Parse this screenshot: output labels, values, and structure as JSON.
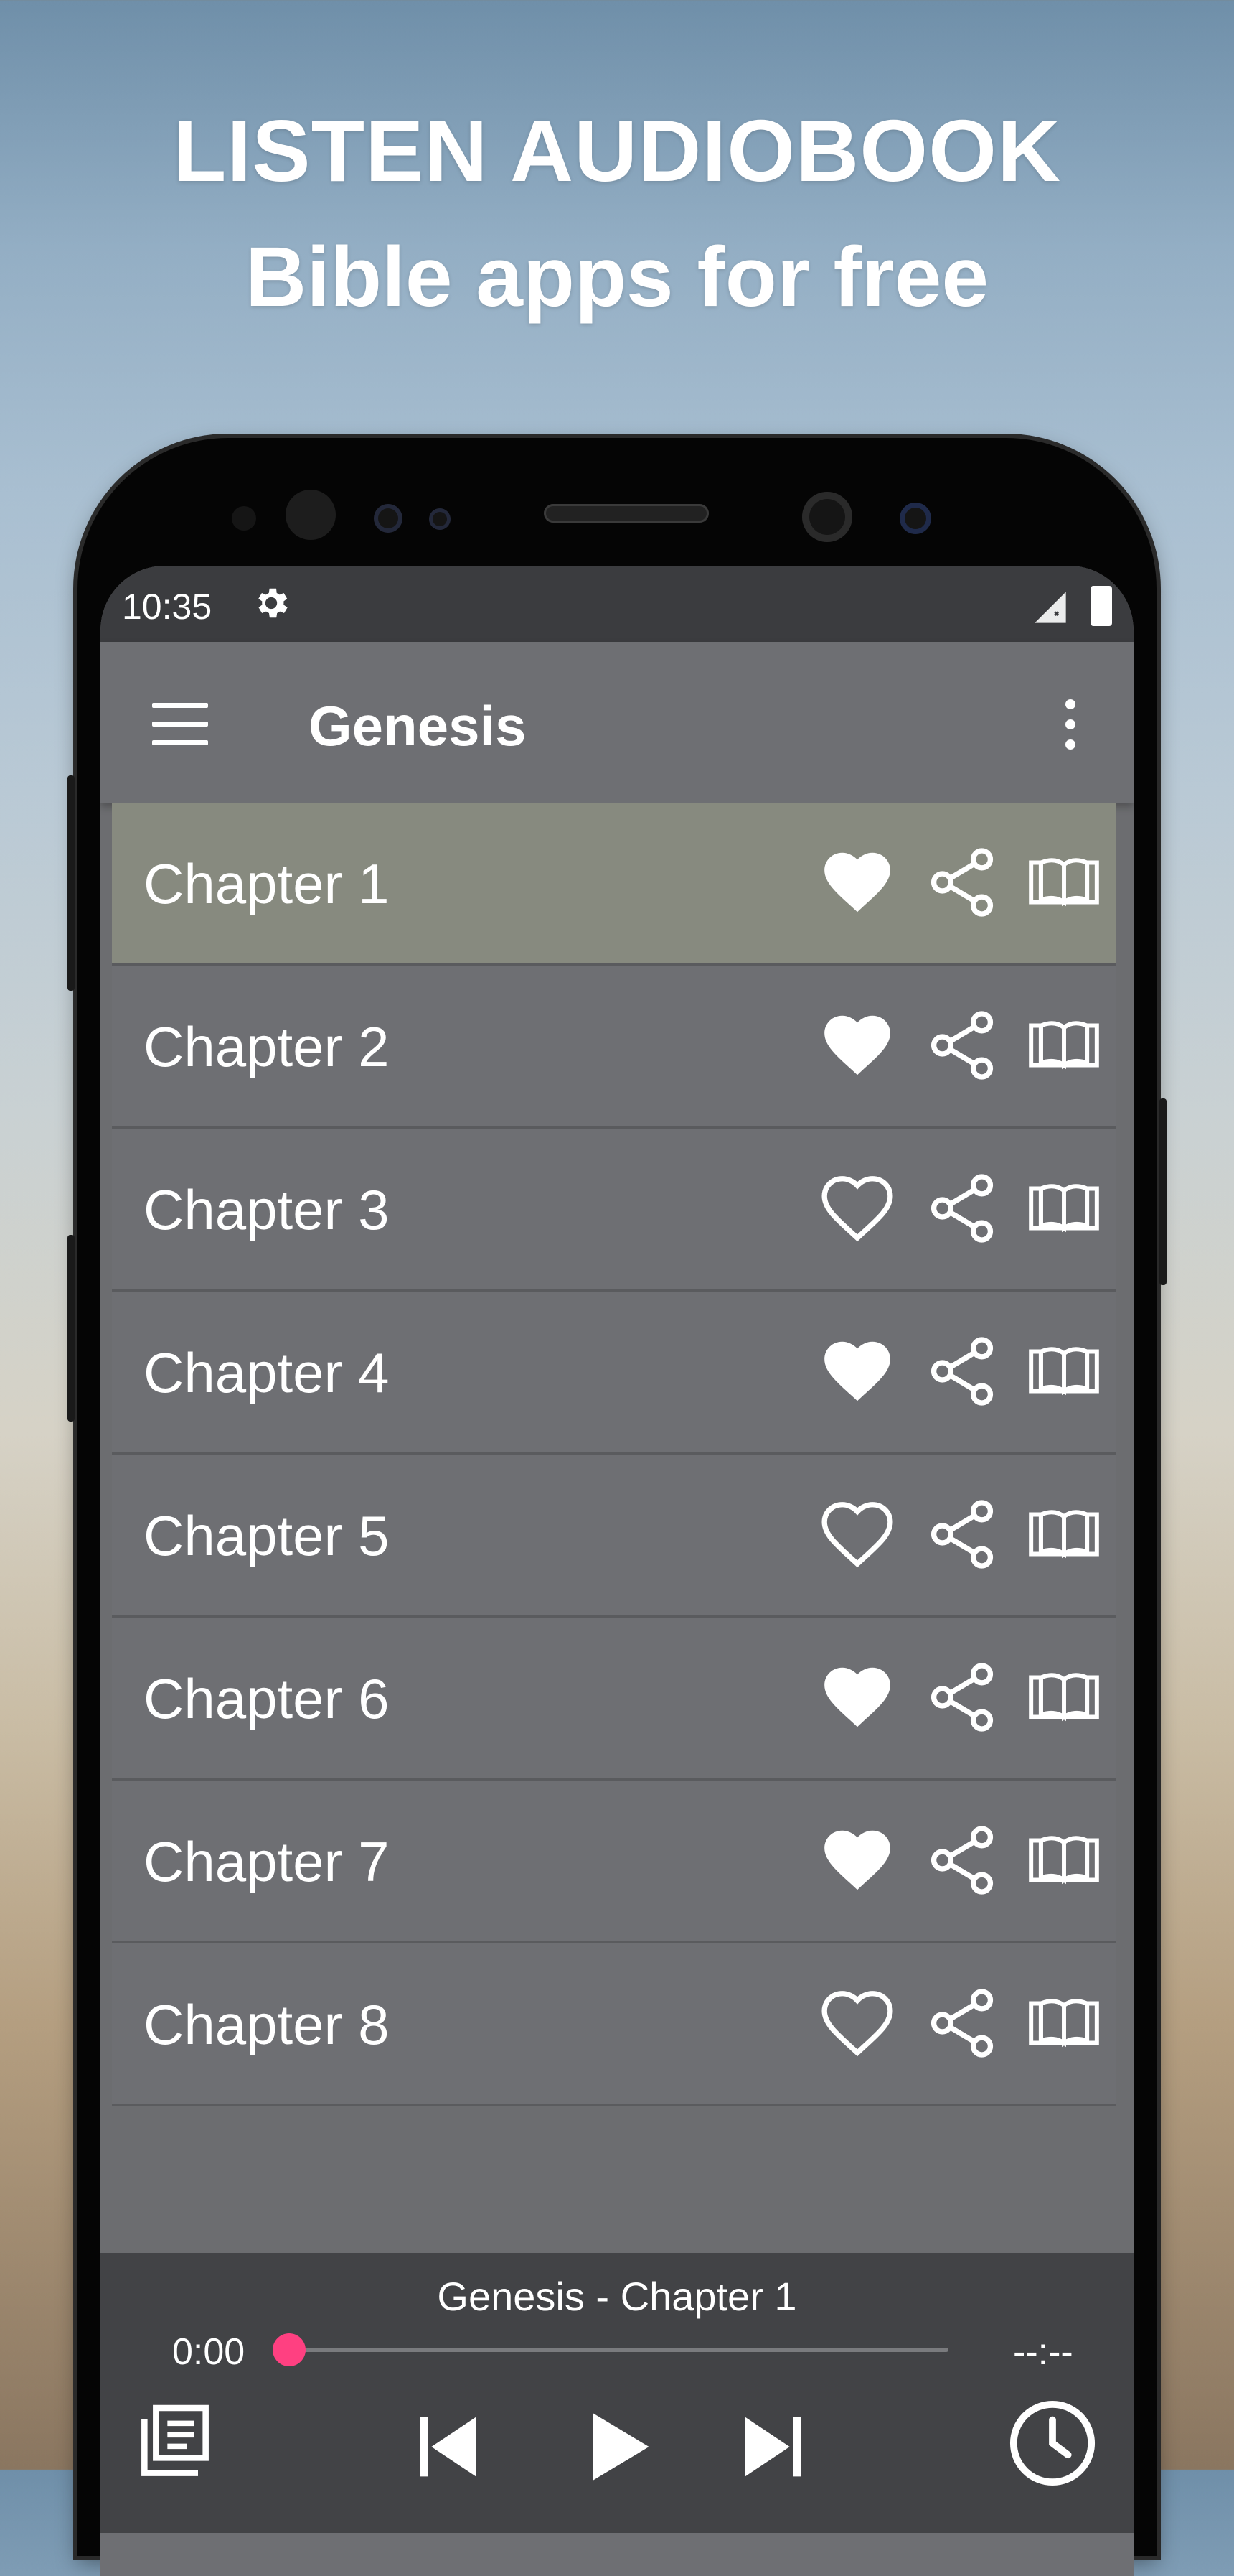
{
  "headline": {
    "line1": "LISTEN AUDIOBOOK",
    "line2": "Bible apps for free"
  },
  "status_bar": {
    "time": "10:35",
    "icons": [
      "gear-icon",
      "signal-icon",
      "battery-icon"
    ]
  },
  "app_bar": {
    "title": "Genesis",
    "icons": [
      "menu-icon",
      "more-vert-icon"
    ]
  },
  "chapters": [
    {
      "label": "Chapter 1",
      "favorite": true,
      "active": true
    },
    {
      "label": "Chapter 2",
      "favorite": true,
      "active": false
    },
    {
      "label": "Chapter 3",
      "favorite": false,
      "active": false
    },
    {
      "label": "Chapter 4",
      "favorite": true,
      "active": false
    },
    {
      "label": "Chapter 5",
      "favorite": false,
      "active": false
    },
    {
      "label": "Chapter 6",
      "favorite": true,
      "active": false
    },
    {
      "label": "Chapter 7",
      "favorite": true,
      "active": false
    },
    {
      "label": "Chapter 8",
      "favorite": false,
      "active": false
    }
  ],
  "player": {
    "now_playing": "Genesis - Chapter 1",
    "current_time": "0:00",
    "end_time": "--:--",
    "progress": 0,
    "accent_color": "#ff4081",
    "controls": [
      "playlist-icon",
      "skip-previous-icon",
      "play-icon",
      "skip-next-icon",
      "timer-icon"
    ]
  },
  "colors": {
    "list_background": "#6e6f73",
    "active_row": "#878a7f",
    "player_background": "#424346"
  }
}
